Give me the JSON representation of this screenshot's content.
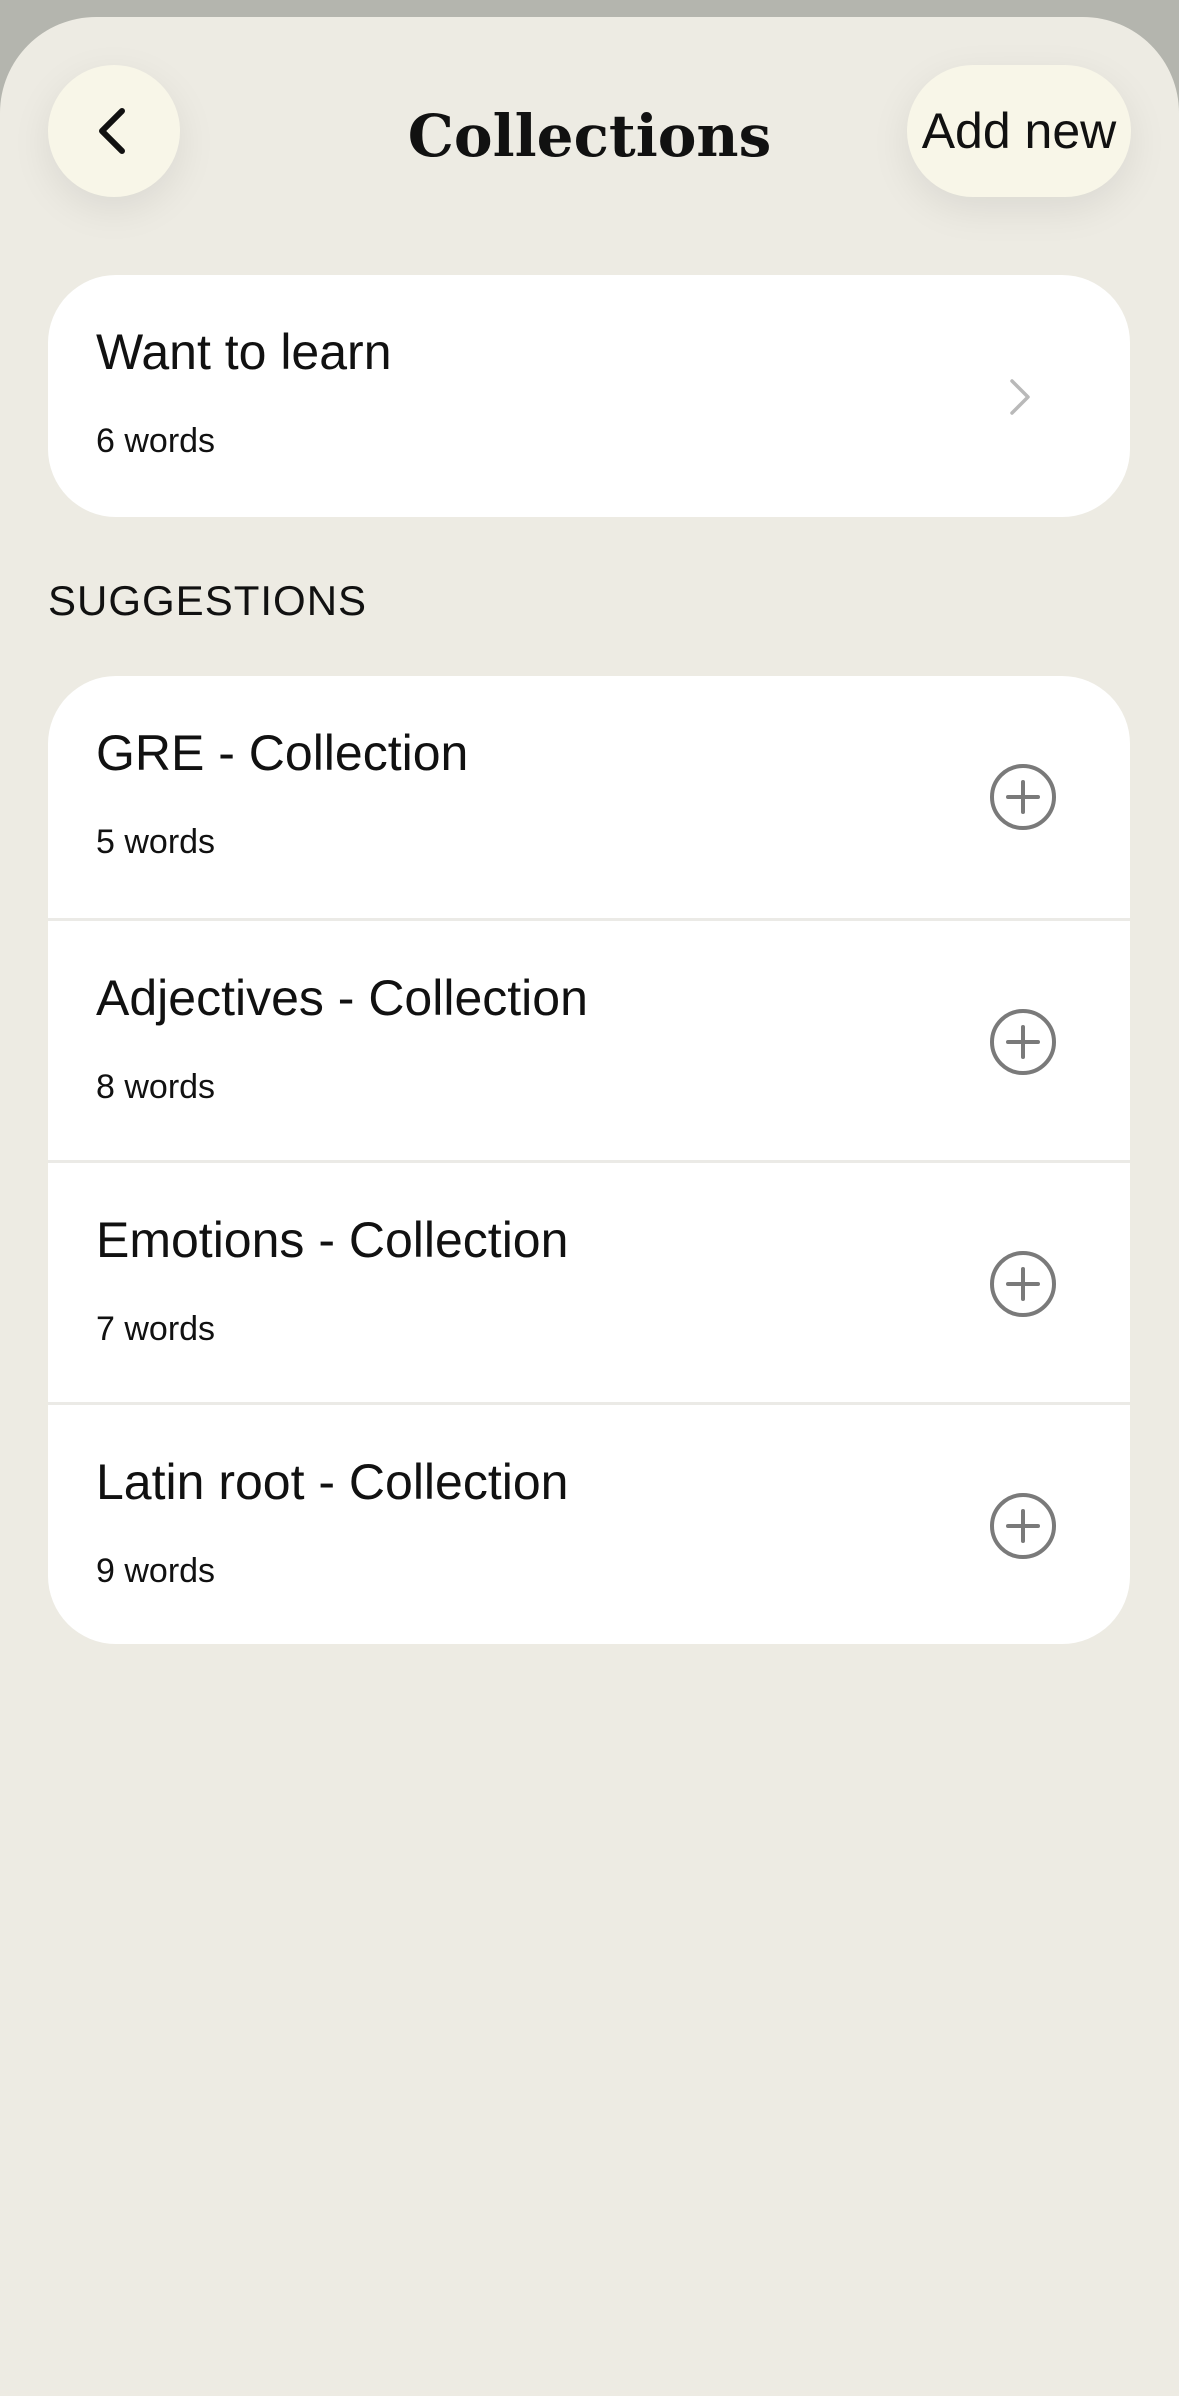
{
  "header": {
    "title": "Collections",
    "add_new_label": "Add new"
  },
  "my_collections": [
    {
      "title": "Want to learn",
      "count": "6 words"
    }
  ],
  "suggestions_heading": "SUGGESTIONS",
  "suggestions": [
    {
      "title": "GRE - Collection",
      "count": "5 words"
    },
    {
      "title": "Adjectives - Collection",
      "count": "8 words"
    },
    {
      "title": "Emotions - Collection",
      "count": "7 words"
    },
    {
      "title": "Latin root - Collection",
      "count": "9 words"
    }
  ],
  "colors": {
    "background": "#edebe3",
    "button_fill": "#f8f6e8",
    "card": "#ffffff",
    "icon_gray": "#7a7a7a"
  }
}
